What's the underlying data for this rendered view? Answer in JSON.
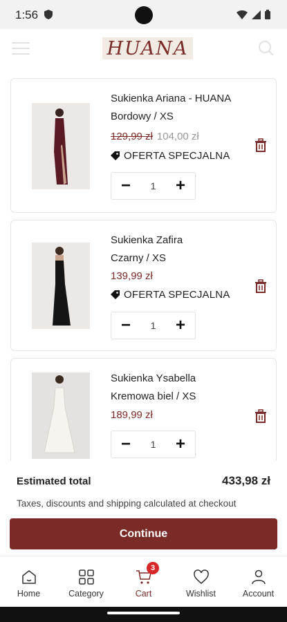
{
  "status_bar": {
    "time": "1:56"
  },
  "header": {
    "logo_text": "HUANA"
  },
  "cart_items": [
    {
      "name": "Sukienka Ariana - HUANA",
      "variant": "Bordowy / XS",
      "old_price": "129,99 zł",
      "price": "104,00 zł",
      "badge": "OFERTA SPECJALNA",
      "quantity": "1"
    },
    {
      "name": "Sukienka Zafira",
      "variant": "Czarny / XS",
      "price": "139,99 zł",
      "badge": "OFERTA SPECJALNA",
      "quantity": "1"
    },
    {
      "name": "Sukienka Ysabella",
      "variant": "Kremowa biel / XS",
      "price": "189,99 zł",
      "quantity": "1"
    }
  ],
  "summary": {
    "label": "Estimated total",
    "total": "433,98 zł",
    "note": "Taxes, discounts and shipping calculated at checkout",
    "continue_label": "Continue"
  },
  "nav": {
    "items": [
      {
        "label": "Home",
        "icon": "home-icon"
      },
      {
        "label": "Category",
        "icon": "grid-icon"
      },
      {
        "label": "Cart",
        "icon": "cart-icon",
        "badge": "3"
      },
      {
        "label": "Wishlist",
        "icon": "heart-icon"
      },
      {
        "label": "Account",
        "icon": "person-icon"
      }
    ]
  },
  "colors": {
    "brand": "#7a2a27",
    "badge": "#d62828"
  }
}
